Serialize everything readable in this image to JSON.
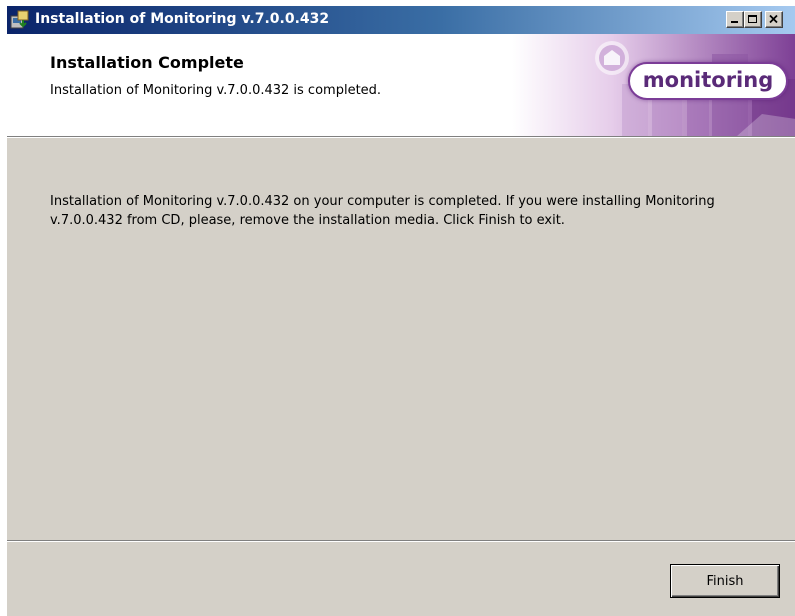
{
  "window": {
    "title": "Installation of Monitoring v.7.0.0.432",
    "icons": {
      "app": "installer-icon",
      "minimize": "minimize-icon",
      "maximize": "maximize-icon",
      "close": "close-icon"
    }
  },
  "header": {
    "title": "Installation Complete",
    "subtitle": "Installation of Monitoring v.7.0.0.432 is completed.",
    "logo_text": "monitoring"
  },
  "body": {
    "message": "Installation of Monitoring v.7.0.0.432 on your computer is completed. If you were installing Monitoring v.7.0.0.432 from CD, please, remove the installation media. Click Finish to exit."
  },
  "footer": {
    "finish_label": "Finish"
  },
  "colors": {
    "titlebar_start": "#0a246a",
    "titlebar_end": "#a6caf0",
    "dialog_bg": "#d4d0c8",
    "brand_purple": "#7b3c97"
  }
}
